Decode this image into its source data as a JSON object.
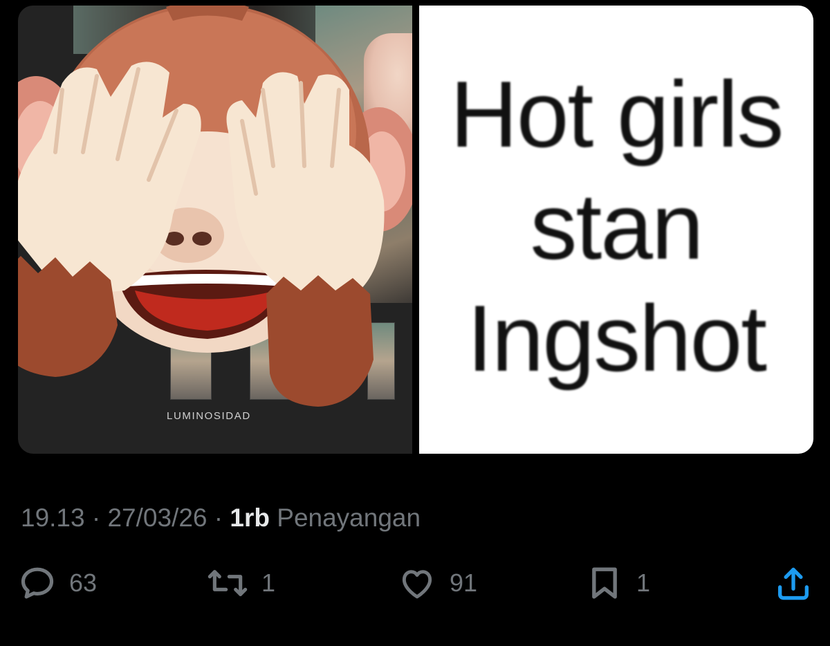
{
  "media": {
    "left_caption": "LUMINOSIDAD",
    "meme_lines": [
      "Hot girls",
      "stan",
      "Ingshot"
    ]
  },
  "meta": {
    "time": "19.13",
    "sep1": " · ",
    "date": "27/03/26",
    "sep2": " · ",
    "views_count": "1rb",
    "views_label": " Penayangan"
  },
  "actions": {
    "reply_count": "63",
    "repost_count": "1",
    "like_count": "91",
    "bookmark_count": "1"
  },
  "colors": {
    "background": "#000000",
    "muted_text": "#71767b",
    "primary_text": "#e7e9ea"
  },
  "icons": [
    "reply-icon",
    "repost-icon",
    "like-icon",
    "bookmark-icon",
    "share-icon",
    "see-no-evil-monkey-emoji"
  ]
}
